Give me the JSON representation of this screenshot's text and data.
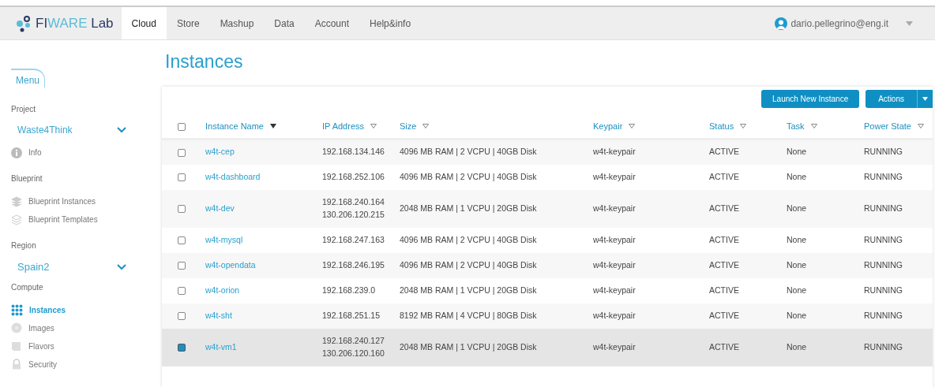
{
  "brand": {
    "name_part1": "FI",
    "name_part2": "WARE",
    "name_part3": "Lab"
  },
  "nav_tabs": [
    {
      "label": "Cloud",
      "selected": true
    },
    {
      "label": "Store",
      "selected": false
    },
    {
      "label": "Mashup",
      "selected": false
    },
    {
      "label": "Data",
      "selected": false
    },
    {
      "label": "Account",
      "selected": false
    },
    {
      "label": "Help&info",
      "selected": false
    }
  ],
  "user": {
    "email": "dario.pellegrino@eng.it"
  },
  "sidebar": {
    "menu_label": "Menu",
    "sections": [
      {
        "heading": "Project",
        "select": "Waste4Think",
        "items": [
          {
            "label": "Info",
            "selected": false
          }
        ]
      },
      {
        "heading": "Blueprint",
        "items": [
          {
            "label": "Blueprint Instances",
            "selected": false
          },
          {
            "label": "Blueprint Templates",
            "selected": false
          }
        ]
      },
      {
        "heading": "Region",
        "select": "Spain2"
      },
      {
        "heading": "Compute",
        "items": [
          {
            "label": "Instances",
            "selected": true
          },
          {
            "label": "Images",
            "selected": false
          },
          {
            "label": "Flavors",
            "selected": false
          },
          {
            "label": "Security",
            "selected": false
          }
        ]
      }
    ]
  },
  "page_title": "Instances",
  "toolbar": {
    "launch_button": "Launch New Instance",
    "actions_button": "Actions"
  },
  "table": {
    "select_all_checked": false,
    "columns": [
      {
        "label": "Instance Name",
        "sorted": true
      },
      {
        "label": "IP Address",
        "sorted": false
      },
      {
        "label": "Size",
        "sorted": false
      },
      {
        "label": "Keypair",
        "sorted": false
      },
      {
        "label": "Status",
        "sorted": false
      },
      {
        "label": "Task",
        "sorted": false
      },
      {
        "label": "Power State",
        "sorted": false
      }
    ],
    "rows": [
      {
        "selected": false,
        "name": "w4t-cep",
        "ips": [
          "192.168.134.146"
        ],
        "size": "4096 MB RAM | 2 VCPU | 40GB Disk",
        "keypair": "w4t-keypair",
        "status": "ACTIVE",
        "task": "None",
        "power_state": "RUNNING"
      },
      {
        "selected": false,
        "name": "w4t-dashboard",
        "ips": [
          "192.168.252.106"
        ],
        "size": "4096 MB RAM | 2 VCPU | 40GB Disk",
        "keypair": "w4t-keypair",
        "status": "ACTIVE",
        "task": "None",
        "power_state": "RUNNING"
      },
      {
        "selected": false,
        "name": "w4t-dev",
        "ips": [
          "192.168.240.164",
          "130.206.120.215"
        ],
        "size": "2048 MB RAM | 1 VCPU | 20GB Disk",
        "keypair": "w4t-keypair",
        "status": "ACTIVE",
        "task": "None",
        "power_state": "RUNNING"
      },
      {
        "selected": false,
        "name": "w4t-mysql",
        "ips": [
          "192.168.247.163"
        ],
        "size": "4096 MB RAM | 2 VCPU | 40GB Disk",
        "keypair": "w4t-keypair",
        "status": "ACTIVE",
        "task": "None",
        "power_state": "RUNNING"
      },
      {
        "selected": false,
        "name": "w4t-opendata",
        "ips": [
          "192.168.246.195"
        ],
        "size": "4096 MB RAM | 2 VCPU | 40GB Disk",
        "keypair": "w4t-keypair",
        "status": "ACTIVE",
        "task": "None",
        "power_state": "RUNNING"
      },
      {
        "selected": false,
        "name": "w4t-orion",
        "ips": [
          "192.168.239.0"
        ],
        "size": "2048 MB RAM | 1 VCPU | 20GB Disk",
        "keypair": "w4t-keypair",
        "status": "ACTIVE",
        "task": "None",
        "power_state": "RUNNING"
      },
      {
        "selected": false,
        "name": "w4t-sht",
        "ips": [
          "192.168.251.15"
        ],
        "size": "8192 MB RAM | 4 VCPU | 80GB Disk",
        "keypair": "w4t-keypair",
        "status": "ACTIVE",
        "task": "None",
        "power_state": "RUNNING"
      },
      {
        "selected": true,
        "name": "w4t-vm1",
        "ips": [
          "192.168.240.127",
          "130.206.120.160"
        ],
        "size": "2048 MB RAM | 1 VCPU | 20GB Disk",
        "keypair": "w4t-keypair",
        "status": "ACTIVE",
        "task": "None",
        "power_state": "RUNNING"
      }
    ]
  }
}
